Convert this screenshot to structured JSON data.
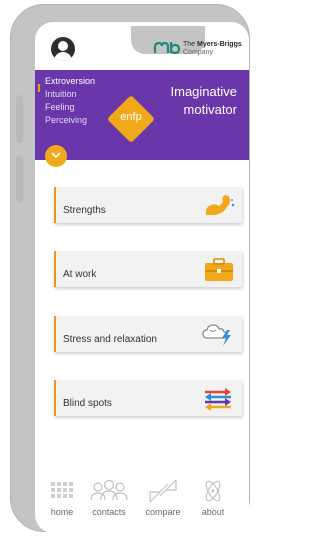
{
  "header": {
    "brand_name_prefix": "The ",
    "brand_name_bold": "Myers-Briggs",
    "brand_sub": "Company"
  },
  "profile": {
    "traits": [
      "Extroversion",
      "Intuition",
      "Feeling",
      "Perceiving"
    ],
    "type_code": "enfp",
    "title": "Imaginative motivator"
  },
  "cards": [
    {
      "label": "Strengths",
      "icon": "flexed-arm-icon"
    },
    {
      "label": "At work",
      "icon": "briefcase-icon"
    },
    {
      "label": "Stress and relaxation",
      "icon": "storm-cloud-icon"
    },
    {
      "label": "Blind spots",
      "icon": "crossing-arrows-icon"
    }
  ],
  "nav": {
    "home": "home",
    "contacts": "contacts",
    "compare": "compare",
    "about": "about"
  },
  "colors": {
    "banner": "#6a37aa",
    "accent_orange": "#f1a91b",
    "card_bg": "#f2f2f2"
  }
}
